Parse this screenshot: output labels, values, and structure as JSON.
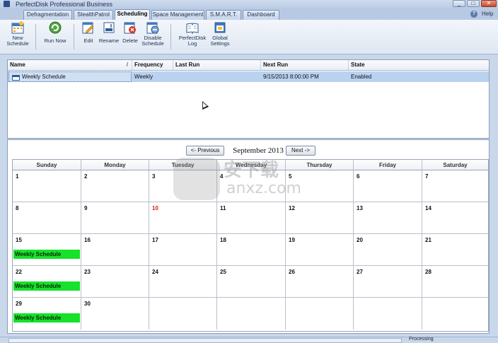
{
  "app": {
    "title": "PerfectDisk Professional Business"
  },
  "window_controls": {
    "minimize": "_",
    "maximize": "□",
    "close": "✕"
  },
  "tabs": [
    "Defragmentation",
    "StealthPatrol",
    "Scheduling",
    "Space Management",
    "S.M.A.R.T.",
    "Dashboard"
  ],
  "active_tab": "Scheduling",
  "help": {
    "icon": "?",
    "label": "Help"
  },
  "toolbar": [
    {
      "label": "New\nSchedule",
      "icon": "new-schedule-icon"
    },
    {
      "label": "Run Now",
      "icon": "run-now-icon"
    },
    {
      "label": "Edit",
      "icon": "edit-icon"
    },
    {
      "label": "Rename",
      "icon": "rename-icon"
    },
    {
      "label": "Delete",
      "icon": "delete-icon"
    },
    {
      "label": "Disable\nSchedule",
      "icon": "disable-schedule-icon"
    },
    {
      "label": "PerfectDisk\nLog",
      "icon": "log-icon"
    },
    {
      "label": "Global\nSettings",
      "icon": "global-settings-icon"
    }
  ],
  "schedule_list": {
    "columns": [
      "Name",
      "Frequency",
      "Last Run",
      "Next Run",
      "State"
    ],
    "rows": [
      {
        "name": "Weekly Schedule",
        "frequency": "Weekly",
        "last_run": "",
        "next_run": "9/15/2013 8:00:00 PM",
        "state": "Enabled"
      }
    ]
  },
  "calendar": {
    "prev_label": "<- Previous",
    "next_label": "Next ->",
    "month_label": "September 2013",
    "weekdays": [
      "Sunday",
      "Monday",
      "Tuesday",
      "Wednesday",
      "Thursday",
      "Friday",
      "Saturday"
    ],
    "weeks": [
      [
        "1",
        "2",
        "3",
        "4",
        "5",
        "6",
        "7"
      ],
      [
        "8",
        "9",
        "10",
        "11",
        "12",
        "13",
        "14"
      ],
      [
        "15",
        "16",
        "17",
        "18",
        "19",
        "20",
        "21"
      ],
      [
        "22",
        "23",
        "24",
        "25",
        "26",
        "27",
        "28"
      ],
      [
        "29",
        "30",
        "",
        "",
        "",
        "",
        ""
      ]
    ],
    "today": "10",
    "today_color": "#d0201a",
    "events": [
      {
        "day": "15",
        "label": "Weekly Schedule"
      },
      {
        "day": "22",
        "label": "Weekly Schedule"
      },
      {
        "day": "29",
        "label": "Weekly Schedule"
      }
    ],
    "event_color": "#16e12b"
  },
  "watermark": {
    "text": "安下载",
    "url": "anxz.com"
  },
  "status": {
    "processing": "Processing"
  }
}
